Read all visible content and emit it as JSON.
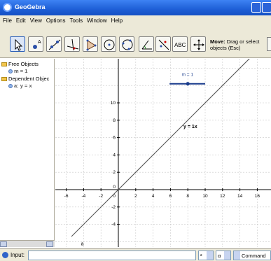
{
  "window": {
    "title": "GeoGebra"
  },
  "menu": [
    "File",
    "Edit",
    "View",
    "Options",
    "Tools",
    "Window",
    "Help"
  ],
  "toolbar": {
    "tools": [
      {
        "name": "move-tool-button",
        "icon": "cursor-arrow-icon",
        "active": true
      },
      {
        "name": "point-tool-button",
        "icon": "point-icon"
      },
      {
        "name": "line-tool-button",
        "icon": "line-through-points-icon"
      },
      {
        "name": "perpendicular-tool-button",
        "icon": "perpendicular-line-icon"
      },
      {
        "name": "polygon-tool-button",
        "icon": "polygon-icon"
      },
      {
        "name": "circle-tool-button",
        "icon": "circle-center-icon"
      },
      {
        "name": "circle-three-points-tool-button",
        "icon": "circle-three-points-icon"
      },
      {
        "name": "angle-tool-button",
        "icon": "angle-icon"
      },
      {
        "name": "reflect-tool-button",
        "icon": "reflect-icon"
      },
      {
        "name": "text-tool-button",
        "icon": "text-abc-icon",
        "label": "ABC"
      },
      {
        "name": "move-view-tool-button",
        "icon": "move-graphics-view-icon"
      }
    ],
    "help_title": "Move:",
    "help_text": "Drag or select objects (Esc)"
  },
  "algebra": {
    "free_header": "Free Objects",
    "free_item": "m = 1",
    "dependent_header": "Dependent Objec",
    "dependent_item": "a: y = x"
  },
  "graphics": {
    "slider_label": "m = 1",
    "function_label": "y = 1x",
    "line_label": "a",
    "x_ticks": [
      "-6",
      "-4",
      "-2",
      "0",
      "2",
      "4",
      "6",
      "8",
      "10",
      "12",
      "14",
      "16"
    ],
    "y_ticks": [
      "10",
      "8",
      "6",
      "4",
      "2",
      "0",
      "-2",
      "-4"
    ]
  },
  "inputbar": {
    "label": "Input:",
    "combo1": "²",
    "combo2": "α",
    "command": "Command ..."
  },
  "colors": {
    "slider": "#1a3c8c",
    "line": "#555555",
    "axes": "#000000"
  }
}
